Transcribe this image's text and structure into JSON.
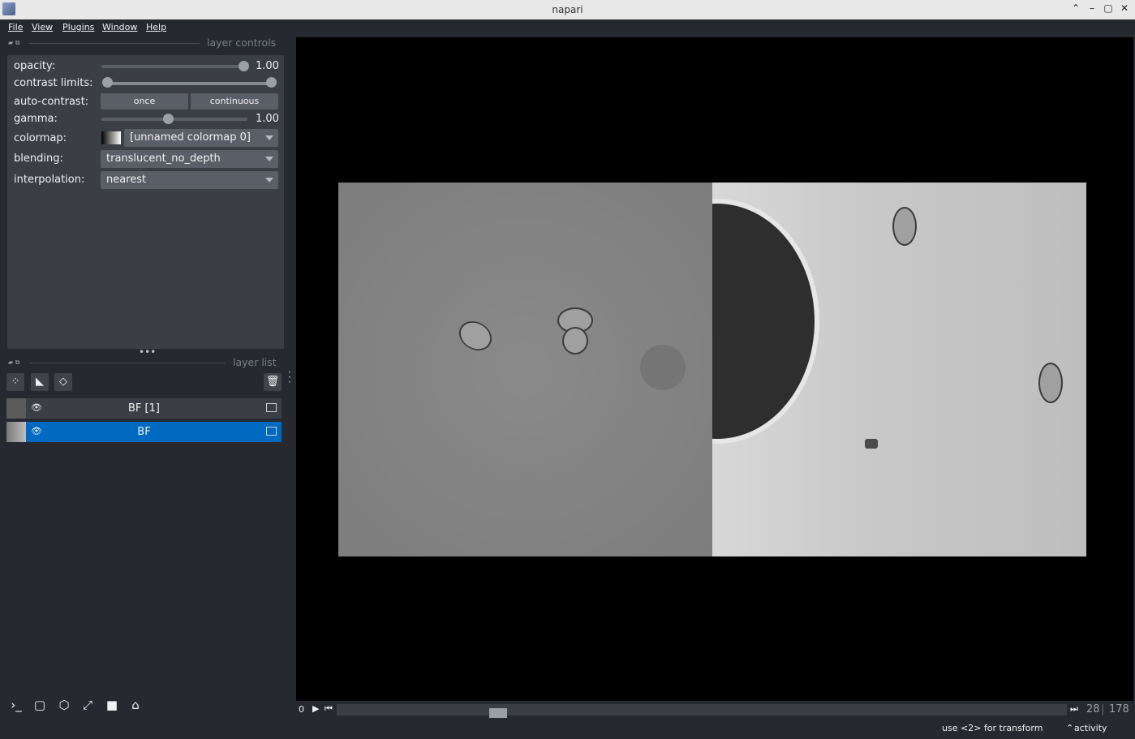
{
  "window": {
    "title": "napari"
  },
  "window_buttons": {
    "up": "⌃",
    "min": "–",
    "max": "▢",
    "close": "✕"
  },
  "menu": {
    "items": [
      "File",
      "View",
      "Plugins",
      "Window",
      "Help"
    ]
  },
  "layer_controls": {
    "dock_title": "layer controls",
    "opacity": {
      "label": "opacity:",
      "value": "1.00",
      "level": 1.0
    },
    "contrast_limits": {
      "label": "contrast limits:",
      "low": 0.0,
      "high": 1.0
    },
    "auto_contrast": {
      "label": "auto-contrast:",
      "once": "once",
      "continuous": "continuous"
    },
    "gamma": {
      "label": "gamma:",
      "value": "1.00",
      "level": 0.45
    },
    "colormap": {
      "label": "colormap:",
      "value": "[unnamed colormap 0]"
    },
    "blending": {
      "label": "blending:",
      "value": "translucent_no_depth"
    },
    "interpolation": {
      "label": "interpolation:",
      "value": "nearest"
    }
  },
  "layer_list": {
    "dock_title": "layer list",
    "layers": [
      {
        "name": "BF [1]",
        "selected": false
      },
      {
        "name": "BF",
        "selected": true
      }
    ]
  },
  "dims": {
    "start": "0",
    "current": "28",
    "total": "178"
  },
  "status": {
    "hint": "use <2> for transform",
    "activity": "activity"
  }
}
